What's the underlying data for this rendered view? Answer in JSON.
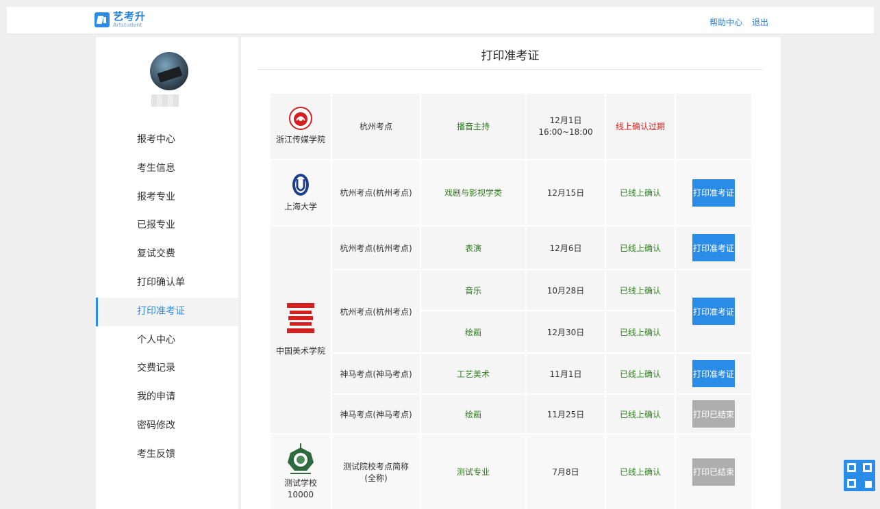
{
  "header": {
    "logo_cn": "艺考升",
    "logo_en": "Artstudent",
    "help_label": "帮助中心",
    "logout_label": "退出"
  },
  "sidebar": {
    "items": [
      {
        "label": "报考中心",
        "active": false
      },
      {
        "label": "考生信息",
        "active": false
      },
      {
        "label": "报考专业",
        "active": false
      },
      {
        "label": "已报专业",
        "active": false
      },
      {
        "label": "复试交费",
        "active": false
      },
      {
        "label": "打印确认单",
        "active": false
      },
      {
        "label": "打印准考证",
        "active": true
      },
      {
        "label": "个人中心",
        "active": false
      },
      {
        "label": "交费记录",
        "active": false
      },
      {
        "label": "我的申请",
        "active": false
      },
      {
        "label": "密码修改",
        "active": false
      },
      {
        "label": "考生反馈",
        "active": false
      }
    ]
  },
  "main": {
    "title": "打印准考证",
    "schools": [
      {
        "name": "浙江传媒学院",
        "logo": "zjcm-seal-icon"
      },
      {
        "name": "上海大学",
        "logo": "shu-emblem-icon"
      },
      {
        "name": "中国美术学院",
        "logo": "caa-mark-icon"
      },
      {
        "name": "测试学校\n10000",
        "logo": "test-school-emblem-icon"
      }
    ],
    "rows": [
      {
        "site": "杭州考点",
        "major": "播音主持",
        "date": "12月1日\n16:00~18:00",
        "status": "线上确认过期",
        "status_color": "#e02020",
        "button": ""
      },
      {
        "site": "杭州考点(杭州考点)",
        "major": "戏剧与影视学类",
        "date": "12月15日",
        "status": "已线上确认",
        "status_color": "#2f7d1f",
        "button": "打印准考证"
      },
      {
        "site": "杭州考点(杭州考点)",
        "major": "表演",
        "date": "12月6日",
        "status": "已线上确认",
        "status_color": "#2f7d1f",
        "button": "打印准考证"
      },
      {
        "site": "杭州考点(杭州考点)",
        "major": "音乐",
        "date": "10月28日",
        "status": "已线上确认",
        "status_color": "#2f7d1f",
        "button": "打印准考证"
      },
      {
        "site": "",
        "major": "绘画",
        "date": "12月30日",
        "status": "已线上确认",
        "status_color": "#2f7d1f",
        "button": ""
      },
      {
        "site": "神马考点(神马考点)",
        "major": "工艺美术",
        "date": "11月1日",
        "status": "已线上确认",
        "status_color": "#2f7d1f",
        "button": "打印准考证"
      },
      {
        "site": "神马考点(神马考点)",
        "major": "绘画",
        "date": "11月25日",
        "status": "已线上确认",
        "status_color": "#2f7d1f",
        "button": "打印已结束"
      },
      {
        "site": "测试院校考点简称(全称)",
        "major": "测试专业",
        "date": "7月8日",
        "status": "已线上确认",
        "status_color": "#2f7d1f",
        "button": "打印已结束"
      }
    ]
  },
  "colors": {
    "accent": "#2a8ce6",
    "confirmed": "#2f7d1f",
    "expired": "#e02020",
    "disabled_button": "#aeaeae"
  }
}
